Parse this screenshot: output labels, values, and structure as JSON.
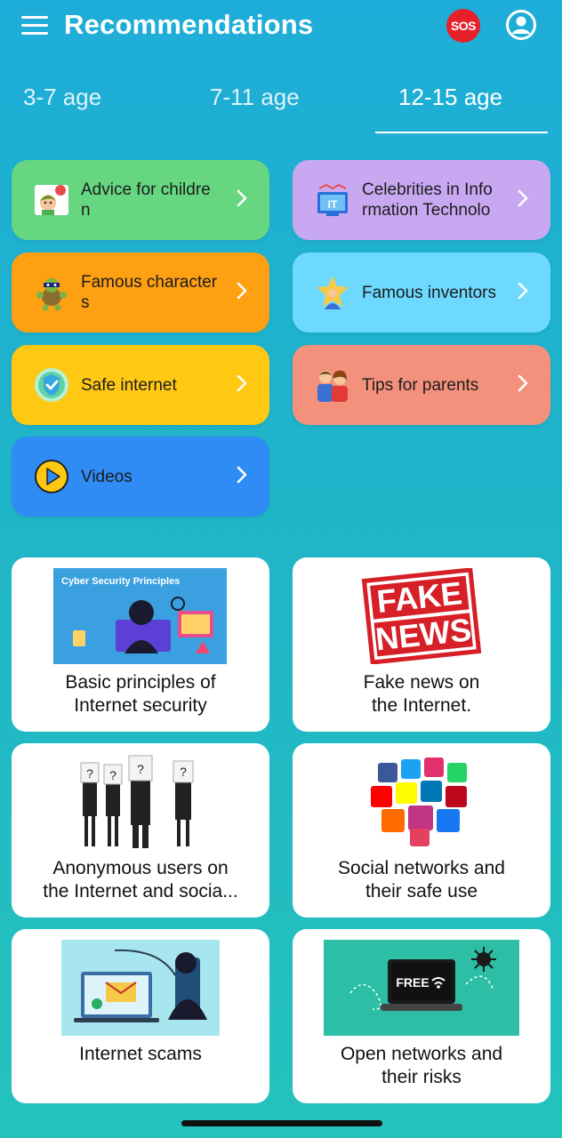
{
  "header": {
    "title": "Recommendations",
    "sos_label": "SOS",
    "menu_icon": "hamburger-menu-icon",
    "profile_icon": "user-profile-icon"
  },
  "tabs": [
    {
      "label": "3-7 age",
      "active": false
    },
    {
      "label": "7-11 age",
      "active": false
    },
    {
      "label": "12-15 age",
      "active": true
    }
  ],
  "categories": [
    {
      "label": "Advice for childre n",
      "line1": "Advice for childre",
      "line2": "n",
      "color": "#66d681",
      "icon": "child-icon"
    },
    {
      "label": "Celebrities in Information Technolo",
      "line1": "Celebrities in Info",
      "line2": "rmation Technolo",
      "color": "#c9a8f2",
      "icon": "it-computer-icon"
    },
    {
      "label": "Famous characters",
      "line1": "Famous character",
      "line2": "s",
      "color": "#ff9f12",
      "icon": "ninja-turtle-icon"
    },
    {
      "label": "Famous inventors",
      "line1": "Famous inventors",
      "line2": "",
      "color": "#6dd9ff",
      "icon": "star-person-icon"
    },
    {
      "label": "Safe internet",
      "line1": "Safe internet",
      "line2": "",
      "color": "#ffc812",
      "icon": "shield-icon"
    },
    {
      "label": "Tips for parents",
      "line1": "Tips for parents",
      "line2": "",
      "color": "#f3917c",
      "icon": "parents-icon"
    },
    {
      "label": "Videos",
      "line1": "Videos",
      "line2": "",
      "color": "#2f8cf4",
      "icon": "play-icon"
    }
  ],
  "articles": [
    {
      "title_l1": "Basic principles of",
      "title_l2": "Internet security",
      "image": "cyber-security-illustration",
      "image_text": "Cyber Security Principles"
    },
    {
      "title_l1": "Fake news on",
      "title_l2": "the Internet.",
      "image": "fake-news-stamp",
      "image_text": "FAKE NEWS"
    },
    {
      "title_l1": "Anonymous users on",
      "title_l2": "the Internet and socia...",
      "image": "anonymous-people-photo"
    },
    {
      "title_l1": "Social networks and",
      "title_l2": "their safe use",
      "image": "social-media-cubes-photo"
    },
    {
      "title_l1": "Internet scams",
      "title_l2": "",
      "image": "internet-scam-illustration"
    },
    {
      "title_l1": "Open networks and",
      "title_l2": "their risks",
      "image": "free-wifi-illustration",
      "image_text": "FREE"
    }
  ],
  "colors": {
    "sos": "#e8202a",
    "bg_top": "#1eadd8",
    "bg_bottom": "#25c2bc"
  }
}
